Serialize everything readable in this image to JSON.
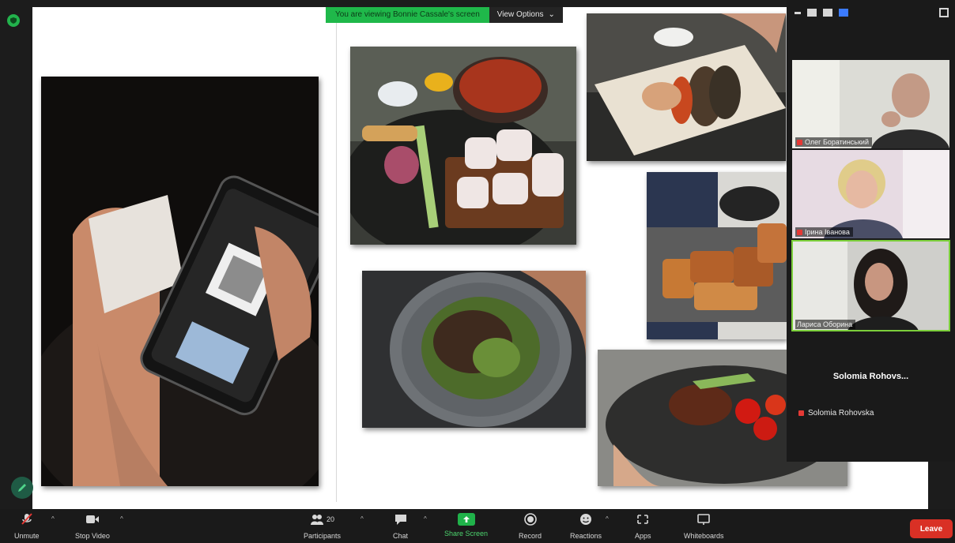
{
  "banner": {
    "viewing_text": "You are viewing Bonnie Cassale's screen",
    "view_options_label": "View Options"
  },
  "participants": [
    {
      "name": "Олег Боратинський"
    },
    {
      "name": "Ірина Іванова"
    },
    {
      "name": "Лариса Оборина"
    }
  ],
  "empty_tile": {
    "display_name": "Solomia  Rohovs...",
    "tag_name": "Solomia Rohovska"
  },
  "toolbar": {
    "unmute": "Unmute",
    "stop_video": "Stop Video",
    "participants": "Participants",
    "participants_count": "20",
    "chat": "Chat",
    "share_screen": "Share Screen",
    "record": "Record",
    "reactions": "Reactions",
    "apps": "Apps",
    "whiteboards": "Whiteboards",
    "leave": "Leave"
  },
  "colors": {
    "banner_green": "#1fb84a",
    "leave_red": "#d93025",
    "active_speaker": "#7ccf3b"
  }
}
